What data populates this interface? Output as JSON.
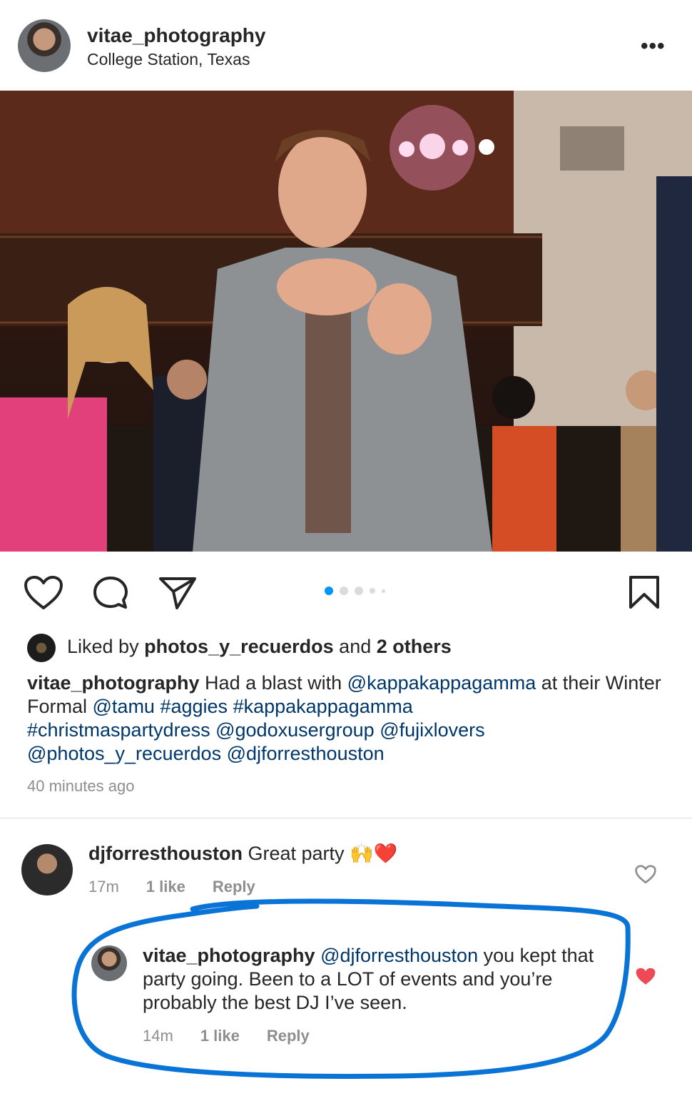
{
  "post": {
    "username": "vitae_photography",
    "location": "College Station, Texas",
    "more_icon": "more-horizontal-icon"
  },
  "actions": {
    "like_icon": "heart-outline-icon",
    "comment_icon": "comment-icon",
    "share_icon": "send-icon",
    "save_icon": "bookmark-icon",
    "carousel_count": 5,
    "carousel_active_index": 0,
    "accent_color": "#0095f6"
  },
  "likes": {
    "prefix": "Liked by ",
    "user": "photos_y_recuerdos",
    "middle": " and ",
    "others": "2 others"
  },
  "caption": {
    "username": "vitae_photography",
    "text_1": " Had a blast with ",
    "mention_1": "@kappakappagamma",
    "text_2": " at their Winter Formal ",
    "mention_2": "@tamu",
    "tag_1": "#aggies",
    "tag_2": "#kappakappagamma",
    "tag_3": "#christmaspartydress",
    "mention_3": "@godoxusergroup",
    "mention_4": "@fujixlovers",
    "mention_5": "@photos_y_recuerdos",
    "mention_6": "@djforresthouston",
    "time_ago": "40 minutes ago"
  },
  "comments": [
    {
      "username": "djforresthouston",
      "text": " Great party ",
      "emoji": "🙌❤️",
      "time": "17m",
      "likes": "1 like",
      "reply": "Reply",
      "heart_icon": "heart-outline-icon"
    },
    {
      "username": "vitae_photography",
      "mention": "@djforresthouston",
      "text": " you kept that party going. Been to a LOT of events and you’re probably the best DJ I’ve seen.",
      "time": "14m",
      "likes": "1 like",
      "reply": "Reply",
      "heart_icon": "heart-filled-icon",
      "heart_color": "#ed4956",
      "highlight_color": "#0a74d6"
    }
  ]
}
